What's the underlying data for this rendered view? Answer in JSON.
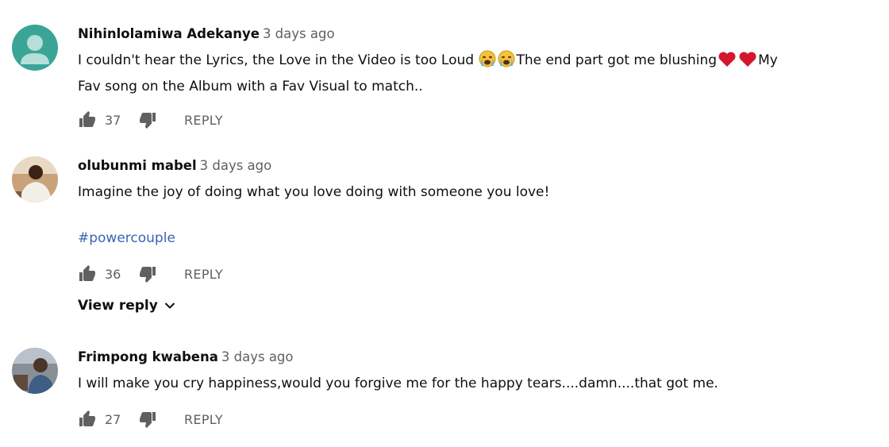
{
  "comments": [
    {
      "author": "Nihinlolamiwa Adekanye",
      "time": "3 days ago",
      "text_line1_a": "I couldn't hear the Lyrics, the Love in the Video is too Loud ",
      "text_line1_b": "The end part got me blushing",
      "text_line1_c": "My",
      "text_line2": "Fav song on the Album with a Fav Visual to match..",
      "likes": "37",
      "reply_label": "REPLY",
      "avatar": "default-user-icon",
      "avatar_color": "#3aa597"
    },
    {
      "author": "olubunmi mabel",
      "time": "3 days ago",
      "text_line1": "Imagine the joy of doing what you love doing with someone you love!",
      "hashtag": "#powercouple",
      "likes": "36",
      "reply_label": "REPLY",
      "view_reply_label": "View reply"
    },
    {
      "author": "Frimpong kwabena",
      "time": "3 days ago",
      "text_line1": "I will make you cry happiness,would you forgive me for the happy tears....damn....that got me.",
      "likes": "27",
      "reply_label": "REPLY"
    }
  ],
  "colors": {
    "link": "#3a63b5",
    "secondary_text": "#606060",
    "heart": "#d3172c"
  }
}
